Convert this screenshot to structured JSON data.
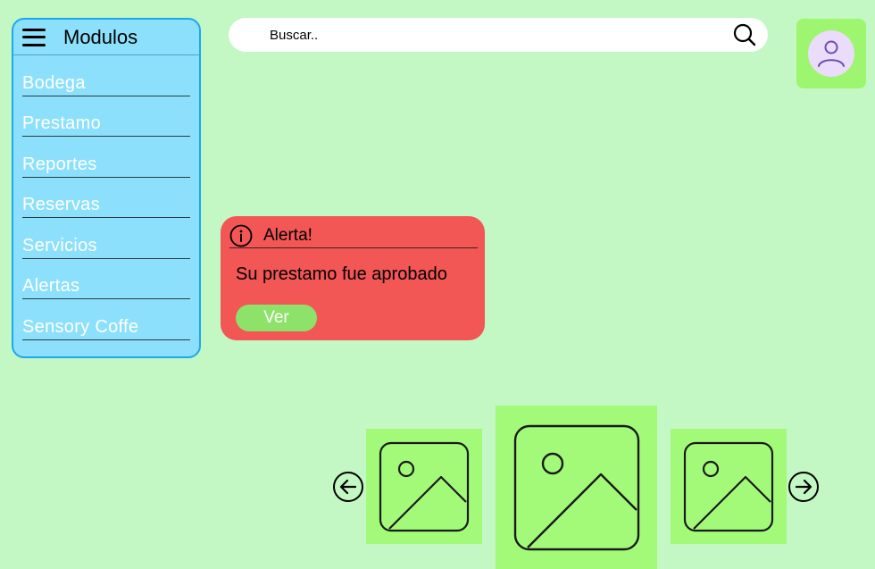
{
  "sidebar": {
    "title": "Modulos",
    "items": [
      {
        "label": "Bodega"
      },
      {
        "label": "Prestamo"
      },
      {
        "label": "Reportes"
      },
      {
        "label": "Reservas"
      },
      {
        "label": "Servicios"
      },
      {
        "label": "Alertas"
      },
      {
        "label": "Sensory Coffe"
      }
    ]
  },
  "search": {
    "placeholder": "Buscar.."
  },
  "alert": {
    "title": "Alerta!",
    "message": "Su prestamo fue aprobado",
    "button_label": "Ver"
  },
  "carousel": {
    "images": [
      "image-placeholder",
      "image-placeholder",
      "image-placeholder"
    ],
    "prev_icon": "arrow-left-circle-icon",
    "next_icon": "arrow-right-circle-icon"
  },
  "colors": {
    "background": "#c3f7c3",
    "sidebar_bg": "#8de0fb",
    "sidebar_border": "#1ea7ef",
    "alert_bg": "#f25655",
    "accent_green": "#a3fa79",
    "button_green": "#8de36a",
    "avatar_bg": "#eadcfa"
  }
}
